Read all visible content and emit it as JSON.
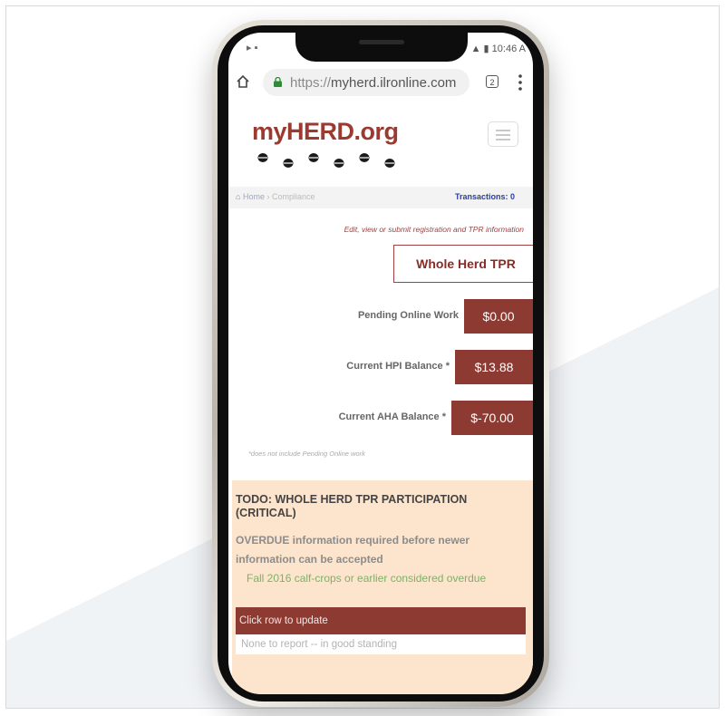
{
  "status_bar": {
    "left_icons": "▸ ▪",
    "time": "10:46 A"
  },
  "browser": {
    "url_protocol": "https://",
    "url_host": "myherd.ilronline.com",
    "tab_count": "2"
  },
  "site": {
    "logo": "myHERD.org",
    "breadcrumb_home": "Home",
    "breadcrumb_sep": "›",
    "breadcrumb_current": "Compliance",
    "transactions_label": "Transactions: 0",
    "edit_link": "Edit, view or submit registration and TPR information",
    "tpr_button": "Whole Herd TPR"
  },
  "balances": [
    {
      "label": "Pending Online Work",
      "value": "$0.00"
    },
    {
      "label": "Current HPI Balance *",
      "value": "$13.88"
    },
    {
      "label": "Current AHA Balance *",
      "value": "$-70.00"
    }
  ],
  "footnote": "*does not include Pending Online work",
  "todo": {
    "title": "TODO: WHOLE HERD TPR PARTICIPATION (CRITICAL)",
    "overdue": "OVERDUE information required before newer information can be accepted",
    "note": "Fall 2016 calf-crops or earlier considered overdue",
    "click_row": "Click row to update",
    "none_row": "None to report -- in good standing"
  },
  "colors": {
    "brand_red": "#8d3a32",
    "todo_bg": "#fde4cc",
    "note_green": "#7fb069",
    "link_blue": "#2c3e9c"
  }
}
